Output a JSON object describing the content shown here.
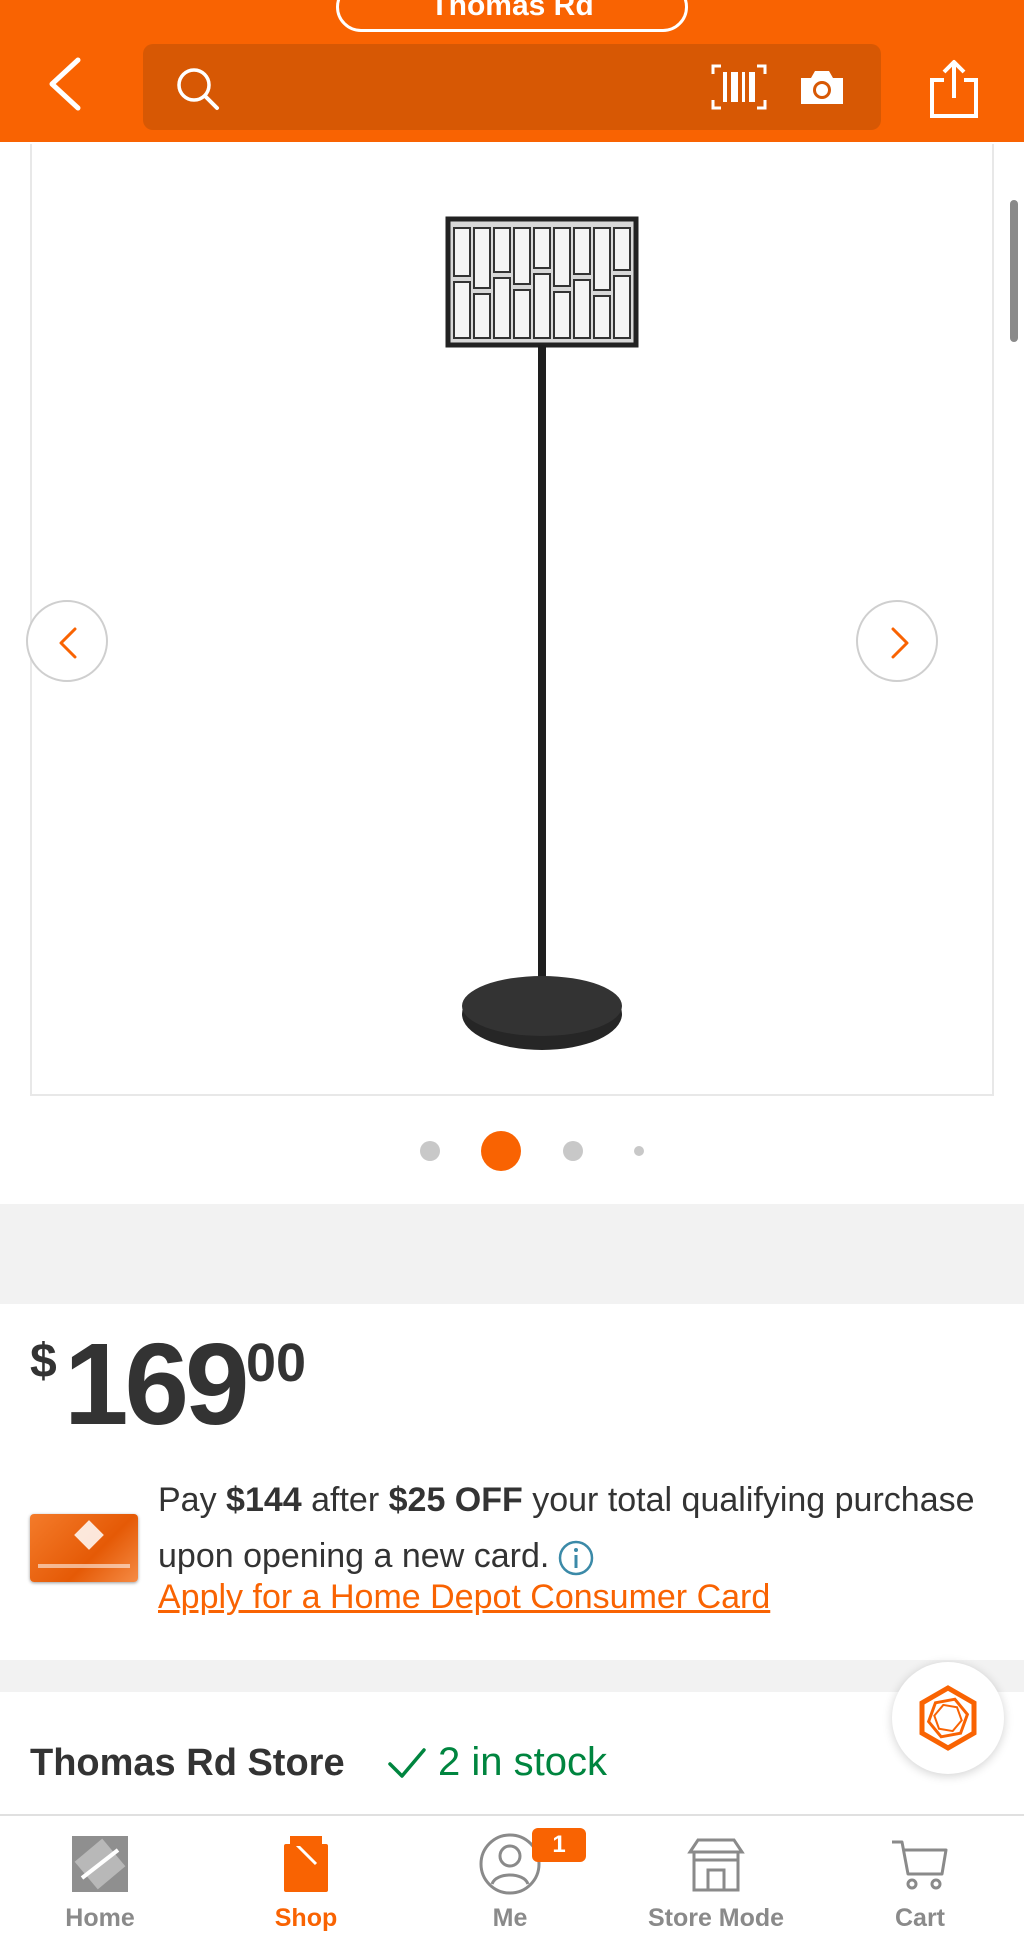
{
  "header": {
    "store_selector_label": "Thomas Rd",
    "search_placeholder": ""
  },
  "gallery": {
    "product_image_alt": "Floor lamp with crystal drum shade",
    "total_dots": 4,
    "active_dot": 2
  },
  "price": {
    "currency": "$",
    "dollars": "169",
    "cents": "00"
  },
  "promo": {
    "prefix": "Pay ",
    "amount": "$144",
    "middle": " after ",
    "discount": "$25 OFF",
    "suffix": " your total qualifying purchase upon opening a new card.",
    "apply_link": "Apply for a Home Depot Consumer Card"
  },
  "store": {
    "name": "Thomas Rd Store",
    "stock": "2 in stock"
  },
  "bottom_nav": {
    "items": [
      {
        "label": "Home",
        "icon": "home-depot-logo-icon"
      },
      {
        "label": "Shop",
        "icon": "shop-bag-icon"
      },
      {
        "label": "Me",
        "icon": "user-icon"
      },
      {
        "label": "Store Mode",
        "icon": "store-icon"
      },
      {
        "label": "Cart",
        "icon": "cart-icon"
      }
    ],
    "active": "Shop",
    "me_badge": "1"
  },
  "colors": {
    "brand_orange": "#f96302",
    "stock_green": "#00853f"
  }
}
